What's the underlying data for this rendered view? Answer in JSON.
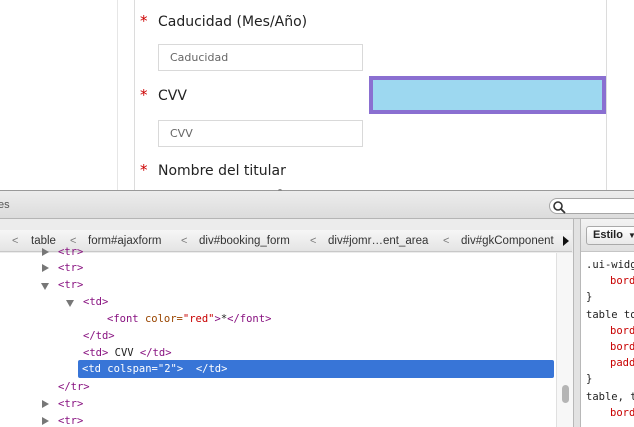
{
  "form": {
    "expiry_label": "Caducidad (Mes/Año)",
    "expiry_placeholder": "Caducidad",
    "cvv_label": "CVV",
    "cvv_placeholder": "CVV",
    "holder_label": "Nombre del titular",
    "required_mark": "*"
  },
  "colors": {
    "required": "#cc0000",
    "highlight_fill": "#9dd8f0",
    "highlight_border": "#8a6fd1",
    "selection": "#3875d7"
  },
  "devtools": {
    "toolbar_partial_text": "es",
    "search_icon": "magnifier-icon",
    "breadcrumbs": [
      {
        "sep": "<",
        "label": "table"
      },
      {
        "sep": "<",
        "label": "form#ajaxform"
      },
      {
        "sep": "<",
        "label": "div#booking_form"
      },
      {
        "sep": "<",
        "label": "div#jomr…ent_area"
      },
      {
        "sep": "<",
        "label": "div#gkComponent"
      }
    ],
    "dom_rows": [
      {
        "tri": "right",
        "open": "<tr>"
      },
      {
        "tri": "right",
        "open": "<tr>"
      },
      {
        "tri": "down",
        "open": "<tr>"
      },
      {
        "tri": "down",
        "open": "<td>"
      },
      {
        "tag_open": "<font ",
        "attr": "color=",
        "val": "\"red\"",
        "gt": ">",
        "text": "*",
        "close": "</font>"
      },
      {
        "close": "</td>"
      },
      {
        "open": "<td>",
        "text": " CVV ",
        "close": "</td>"
      },
      {
        "tag_open": "<td ",
        "attr": "colspan=",
        "val": "\"2\"",
        "gt": ">",
        "text": " ",
        "close": " </td>"
      },
      {
        "close": "</tr>"
      },
      {
        "tri": "right",
        "open": "<tr>"
      },
      {
        "tri": "right",
        "open": "<tr>"
      }
    ],
    "styles_tab_label": "Estilo",
    "styles_lines": [
      ".ui-widg",
      "bord",
      "}",
      "table to",
      "bord",
      "bord",
      "padd",
      "}",
      "table, t",
      "bord"
    ]
  }
}
